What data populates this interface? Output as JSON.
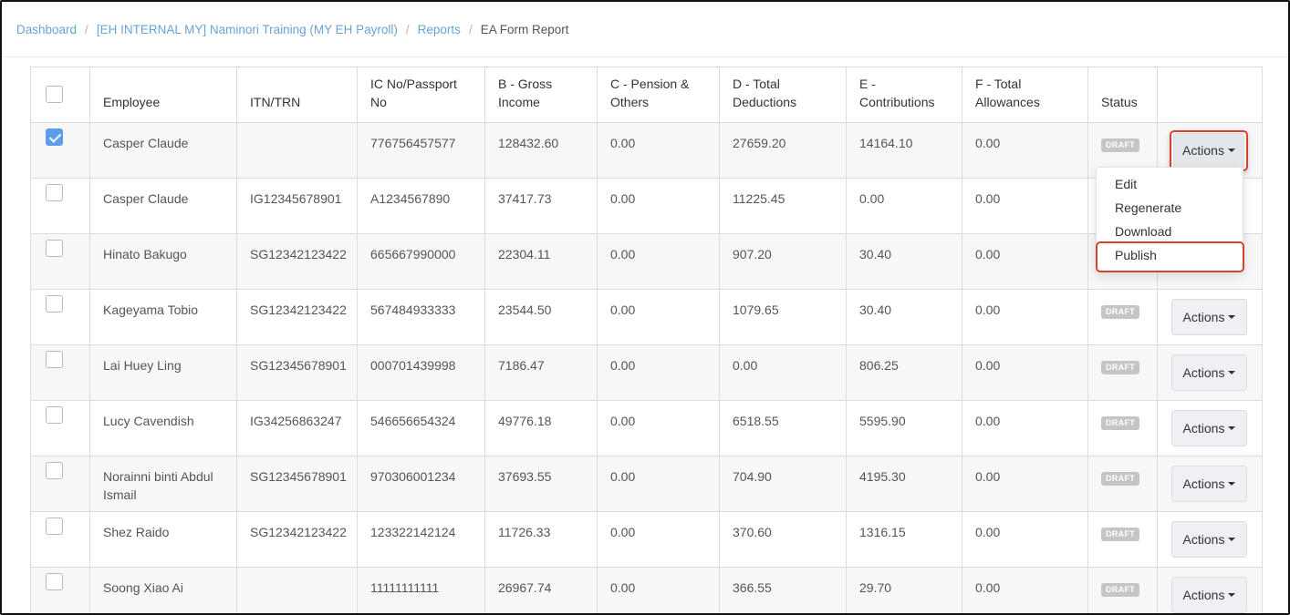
{
  "breadcrumb": {
    "items": [
      "Dashboard",
      "[EH INTERNAL MY] Naminori Training (MY EH Payroll)",
      "Reports"
    ],
    "current": "EA Form Report"
  },
  "table": {
    "headers": {
      "employee": "Employee",
      "itn": "ITN/TRN",
      "ic_line1": "IC No/Passport",
      "ic_line2": "No",
      "gross_line1": "B - Gross",
      "gross_line2": "Income",
      "pension_line1": "C - Pension &",
      "pension_line2": "Others",
      "deductions_line1": "D - Total",
      "deductions_line2": "Deductions",
      "contributions_line1": "E -",
      "contributions_line2": "Contributions",
      "allowances_line1": "F - Total",
      "allowances_line2": "Allowances",
      "status": "Status"
    },
    "rows": [
      {
        "checked": true,
        "employee": "Casper Claude",
        "itn": "",
        "ic": "776756457577",
        "gross": "128432.60",
        "pension": "0.00",
        "deductions": "27659.20",
        "contributions": "14164.10",
        "allowances": "0.00",
        "status": "DRAFT",
        "action": "Actions"
      },
      {
        "checked": false,
        "employee": "Casper Claude",
        "itn": "IG12345678901",
        "ic": "A1234567890",
        "gross": "37417.73",
        "pension": "0.00",
        "deductions": "11225.45",
        "contributions": "0.00",
        "allowances": "0.00",
        "status": "",
        "action": ""
      },
      {
        "checked": false,
        "employee": "Hinato Bakugo",
        "itn": "SG12342123422",
        "ic": "665667990000",
        "gross": "22304.11",
        "pension": "0.00",
        "deductions": "907.20",
        "contributions": "30.40",
        "allowances": "0.00",
        "status": "",
        "action": ""
      },
      {
        "checked": false,
        "employee": "Kageyama Tobio",
        "itn": "SG12342123422",
        "ic": "567484933333",
        "gross": "23544.50",
        "pension": "0.00",
        "deductions": "1079.65",
        "contributions": "30.40",
        "allowances": "0.00",
        "status": "DRAFT",
        "action": "Actions"
      },
      {
        "checked": false,
        "employee": "Lai Huey Ling",
        "itn": "SG12345678901",
        "ic": "000701439998",
        "gross": "7186.47",
        "pension": "0.00",
        "deductions": "0.00",
        "contributions": "806.25",
        "allowances": "0.00",
        "status": "DRAFT",
        "action": "Actions"
      },
      {
        "checked": false,
        "employee": "Lucy Cavendish",
        "itn": "IG34256863247",
        "ic": "546656654324",
        "gross": "49776.18",
        "pension": "0.00",
        "deductions": "6518.55",
        "contributions": "5595.90",
        "allowances": "0.00",
        "status": "DRAFT",
        "action": "Actions"
      },
      {
        "checked": false,
        "employee": "Norainni binti Abdul Ismail",
        "itn": "SG12345678901",
        "ic": "970306001234",
        "gross": "37693.55",
        "pension": "0.00",
        "deductions": "704.90",
        "contributions": "4195.30",
        "allowances": "0.00",
        "status": "DRAFT",
        "action": "Actions"
      },
      {
        "checked": false,
        "employee": "Shez Raido",
        "itn": "SG12342123422",
        "ic": "123322142124",
        "gross": "11726.33",
        "pension": "0.00",
        "deductions": "370.60",
        "contributions": "1316.15",
        "allowances": "0.00",
        "status": "DRAFT",
        "action": "Actions"
      },
      {
        "checked": false,
        "employee": "Soong Xiao Ai",
        "itn": "",
        "ic": "11111111111",
        "gross": "26967.74",
        "pension": "0.00",
        "deductions": "366.55",
        "contributions": "29.70",
        "allowances": "0.00",
        "status": "DRAFT",
        "action": "Actions"
      }
    ]
  },
  "dropdown": {
    "items": [
      "Edit",
      "Regenerate",
      "Download",
      "Publish"
    ]
  },
  "colors": {
    "link": "#6aa3d8",
    "highlight": "#d6422b",
    "checkbox_checked": "#5b9ef0",
    "badge": "#c5c5c5"
  },
  "icons": [
    "check-icon",
    "caret-down-icon"
  ]
}
